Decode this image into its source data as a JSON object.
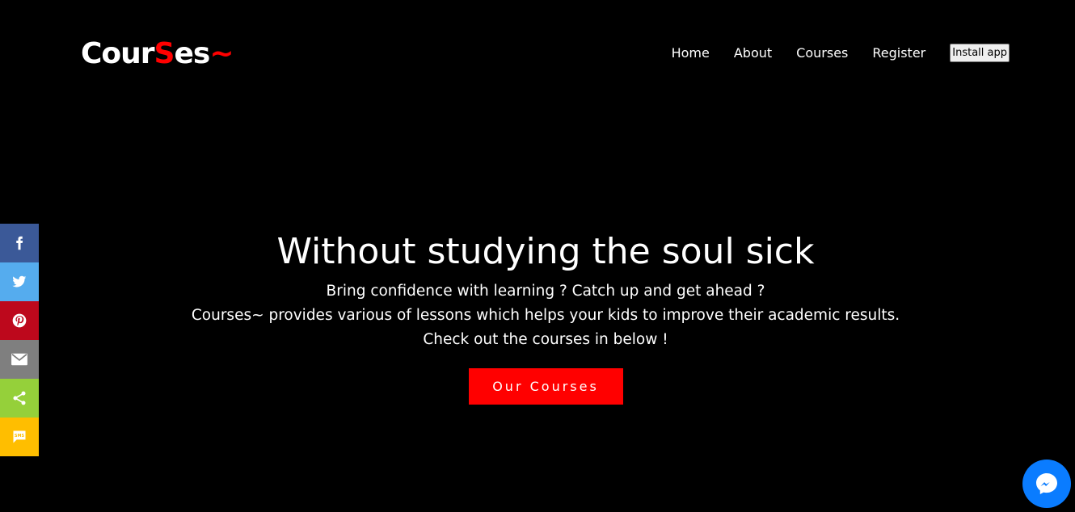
{
  "logo": {
    "part1": "Cour",
    "part2": "S",
    "part3": "es",
    "part4": "~"
  },
  "nav": {
    "items": [
      {
        "label": "Home"
      },
      {
        "label": "About"
      },
      {
        "label": "Courses"
      },
      {
        "label": "Register"
      }
    ],
    "install_label": "Install app"
  },
  "hero": {
    "title": "Without studying the soul sick",
    "line1": "Bring confidence with learning ? Catch up and get ahead ?",
    "line2": "Courses~ provides various of lessons which helps your kids to improve their academic results. Check out the courses in below !",
    "cta_label": "Our Courses"
  },
  "share": {
    "items": [
      {
        "icon": "facebook-icon",
        "color": "#3b5998"
      },
      {
        "icon": "twitter-icon",
        "color": "#55acee"
      },
      {
        "icon": "pinterest-icon",
        "color": "#bd081c"
      },
      {
        "icon": "email-icon",
        "color": "#7f7f7f"
      },
      {
        "icon": "share-icon",
        "color": "#95d03a"
      },
      {
        "icon": "sms-icon",
        "color": "#ffbe00"
      }
    ]
  },
  "colors": {
    "accent": "#ff0000",
    "background": "#000000",
    "messenger": "#0a7cff"
  }
}
